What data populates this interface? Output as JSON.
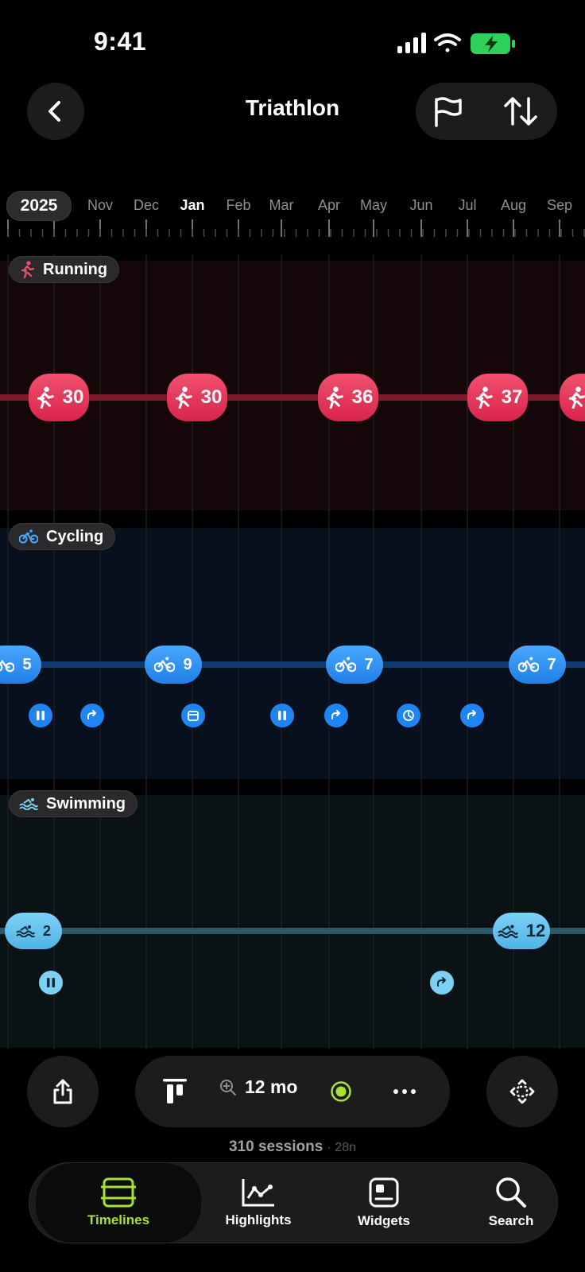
{
  "status_bar": {
    "time": "9:41"
  },
  "header": {
    "title": "Triathlon"
  },
  "axis": {
    "year": "2025",
    "months": [
      "Nov",
      "Dec",
      "Jan",
      "Feb",
      "Mar",
      "Apr",
      "May",
      "Jun",
      "Jul",
      "Aug",
      "Sep"
    ],
    "bold_month": "Jan"
  },
  "running": {
    "label": "Running",
    "color": "#e23355",
    "bubbles": [
      "30",
      "30",
      "36",
      "37"
    ]
  },
  "cycling": {
    "label": "Cycling",
    "color": "#1f85f5",
    "bubbles": [
      "5",
      "9",
      "7",
      "7"
    ]
  },
  "swimming": {
    "label": "Swimming",
    "color": "#7cd0f2",
    "bubbles": [
      "2",
      "12"
    ]
  },
  "controls": {
    "zoom_label": "12 mo",
    "sessions_count": "310 sessions",
    "sessions_extra": "· 28n"
  },
  "tabs": [
    {
      "label": "Timelines",
      "icon": "timelines-icon",
      "active": true
    },
    {
      "label": "Highlights",
      "icon": "highlights-icon",
      "active": false
    },
    {
      "label": "Widgets",
      "icon": "widgets-icon",
      "active": false
    },
    {
      "label": "Search",
      "icon": "search-icon",
      "active": false
    }
  ],
  "colors": {
    "accent": "#a6e22e",
    "background": "#000000"
  }
}
